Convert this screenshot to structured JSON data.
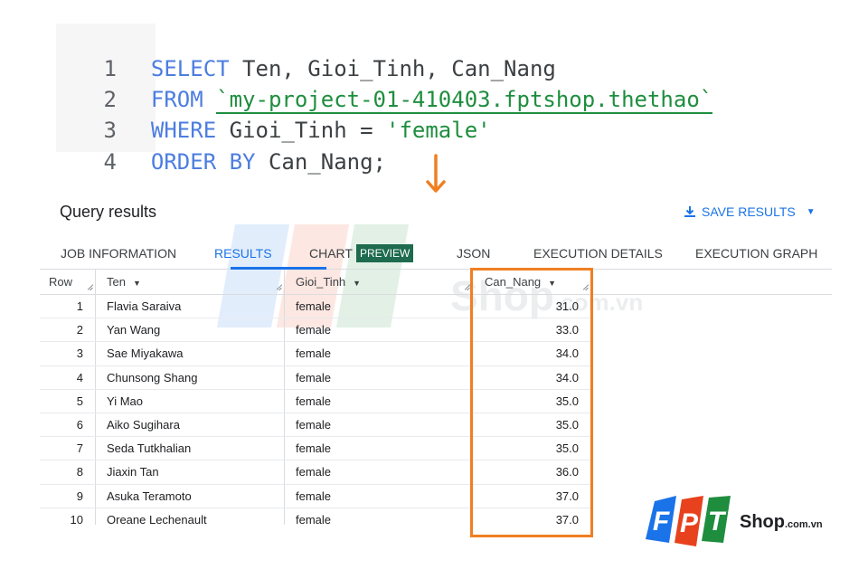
{
  "query": {
    "lines": [
      {
        "n": "1",
        "kw": "SELECT",
        "rest": " Ten, Gioi_Tinh, Can_Nang"
      },
      {
        "n": "2",
        "kw": "FROM",
        "table": "`my-project-01-410403.fptshop.thethao`"
      },
      {
        "n": "3",
        "kw": "WHERE",
        "rest": " Gioi_Tinh = ",
        "str": "'female'"
      },
      {
        "n": "4",
        "kw": "ORDER BY",
        "rest": " Can_Nang;"
      }
    ]
  },
  "results": {
    "title": "Query results",
    "save_label": "SAVE RESULTS",
    "tabs": {
      "job": "JOB INFORMATION",
      "results": "RESULTS",
      "chart": "CHART",
      "preview": "PREVIEW",
      "json": "JSON",
      "details": "EXECUTION DETAILS",
      "graph": "EXECUTION GRAPH"
    },
    "columns": {
      "row": "Row",
      "ten": "Ten",
      "gioi": "Gioi_Tinh",
      "can": "Can_Nang"
    },
    "rows": [
      {
        "row": "1",
        "ten": "Flavia Saraiva",
        "gioi": "female",
        "can": "31.0"
      },
      {
        "row": "2",
        "ten": "Yan Wang",
        "gioi": "female",
        "can": "33.0"
      },
      {
        "row": "3",
        "ten": "Sae Miyakawa",
        "gioi": "female",
        "can": "34.0"
      },
      {
        "row": "4",
        "ten": "Chunsong Shang",
        "gioi": "female",
        "can": "34.0"
      },
      {
        "row": "5",
        "ten": "Yi Mao",
        "gioi": "female",
        "can": "35.0"
      },
      {
        "row": "6",
        "ten": "Aiko Sugihara",
        "gioi": "female",
        "can": "35.0"
      },
      {
        "row": "7",
        "ten": "Seda Tutkhalian",
        "gioi": "female",
        "can": "35.0"
      },
      {
        "row": "8",
        "ten": "Jiaxin Tan",
        "gioi": "female",
        "can": "36.0"
      },
      {
        "row": "9",
        "ten": "Asuka Teramoto",
        "gioi": "female",
        "can": "37.0"
      },
      {
        "row": "10",
        "ten": "Oreane Lechenault",
        "gioi": "female",
        "can": "37.0"
      }
    ]
  },
  "branding": {
    "logo_letters": "FPT",
    "logo_text": "Shop",
    "logo_suffix": ".com.vn",
    "watermark_text": "Shop",
    "watermark_suffix": ".com.vn"
  },
  "colors": {
    "accent": "#1a73e8",
    "highlight": "#f07e22",
    "sql_keyword": "#4d7de0",
    "sql_string": "#1e8e3e"
  }
}
